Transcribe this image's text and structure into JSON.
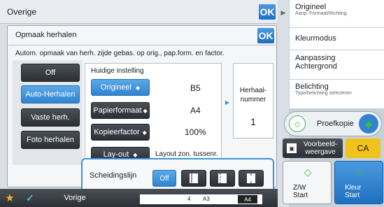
{
  "header": {
    "title": "Overige",
    "ok": "OK"
  },
  "dialog": {
    "title": "Opmaak herhalen",
    "ok": "OK",
    "description": "Autom. opmaak van herh. zijde gebas. op orig., pap.form. en factor.",
    "modes": [
      {
        "label": "Off",
        "selected": false
      },
      {
        "label": "Auto-Herhalen",
        "selected": true
      },
      {
        "label": "Vaste herh.",
        "selected": false
      },
      {
        "label": "Foto herhalen",
        "selected": false
      }
    ],
    "current_settings_label": "Huidige instelling",
    "settings": [
      {
        "label": "Origineel",
        "value": "B5"
      },
      {
        "label": "Papierformaat",
        "value": "A4"
      },
      {
        "label": "Kopieerfactor",
        "value": "100%"
      },
      {
        "label": "Lay-out",
        "value": "Layout zon. tussenr."
      }
    ],
    "repeat_number_label": "Herhaal-\nnummer",
    "repeat_number_value": "1",
    "separator": {
      "label": "Scheidingslijn",
      "off_label": "Off",
      "options": [
        "line-option-1",
        "line-option-2",
        "line-option-3"
      ]
    }
  },
  "sidebar": {
    "items": [
      {
        "label": "Origineel",
        "sub": "Aanp. Formaat/Richting."
      },
      {
        "label": "Kleurmodus",
        "sub": ""
      },
      {
        "label": "Aanpassing Achtergrond",
        "sub": ""
      },
      {
        "label": "Belichting",
        "sub": "Type/belichting selecteren"
      }
    ],
    "proof_copy": "Proefkopie",
    "preview": "Voorbeeld-\nweergave",
    "ca": "CA",
    "start_bw": "Z/W\nStart",
    "start_color": "Kleur\nStart"
  },
  "footer": {
    "previous": "Vorige",
    "paper1": "A3",
    "paper2": "A4",
    "num": "4"
  },
  "colors": {
    "accent": "#2f83cf",
    "selected": "#3b93de",
    "dark_button": "#33373d",
    "green": "#3cb84a"
  }
}
